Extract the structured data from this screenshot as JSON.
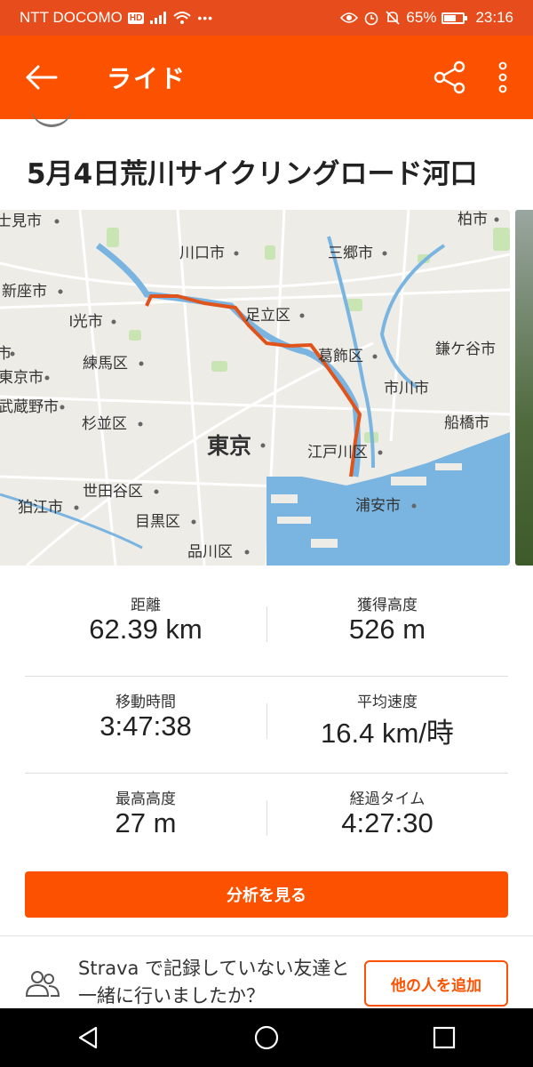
{
  "status_bar": {
    "carrier": "NTT DOCOMO",
    "hd_badge": "HD",
    "battery_percent": "65%",
    "battery_level": 0.65,
    "time": "23:16"
  },
  "app_bar": {
    "title": "ライド",
    "back_icon": "arrow-left-icon",
    "share_icon": "share-icon",
    "more_icon": "more-vert-icon"
  },
  "activity": {
    "title": "5月4日荒川サイクリングロード河口"
  },
  "map": {
    "labels": {
      "fujimi": "士見市",
      "kawaguchi": "川口市",
      "misato": "三郷市",
      "kashiwa": "柏市",
      "niiza": "新座市",
      "hikari": "l光市",
      "adachi": "足立区",
      "katsushika": "葛飾区",
      "kamagaya": "鎌ケ谷市",
      "nerima": "練馬区",
      "ichikawa": "市川市",
      "higashi": "東京市",
      "musashino": "武蔵野市",
      "suginami": "杉並区",
      "funabashi": "船橋市",
      "tokyo": "東京",
      "edogawa": "江戸川区",
      "setagaya": "世田谷区",
      "komae": "狛江市",
      "meguro": "目黒区",
      "urayasu": "浦安市",
      "shinagawa": "品川区",
      "edge": "市"
    },
    "colors": {
      "land": "#eeece6",
      "water": "#7ab4e0",
      "park": "#c9e5b3",
      "road": "#ffffff",
      "route": "#e0541b"
    }
  },
  "stats": [
    {
      "label": "距離",
      "value": "62.39 km"
    },
    {
      "label": "獲得高度",
      "value": "526 m"
    },
    {
      "label": "移動時間",
      "value": "3:47:38"
    },
    {
      "label": "平均速度",
      "value": "16.4 km/時"
    },
    {
      "label": "最高高度",
      "value": "27 m"
    },
    {
      "label": "経過タイム",
      "value": "4:27:30"
    }
  ],
  "analyze_button": {
    "label": "分析を見る"
  },
  "friends": {
    "icon": "people-icon",
    "prompt": "Strava で記録していない友達と一緒に行いましたか？",
    "add_button": "他の人を追加"
  },
  "nav_bar": {
    "back_icon": "nav-back-icon",
    "home_icon": "nav-home-icon",
    "recents_icon": "nav-recents-icon"
  }
}
